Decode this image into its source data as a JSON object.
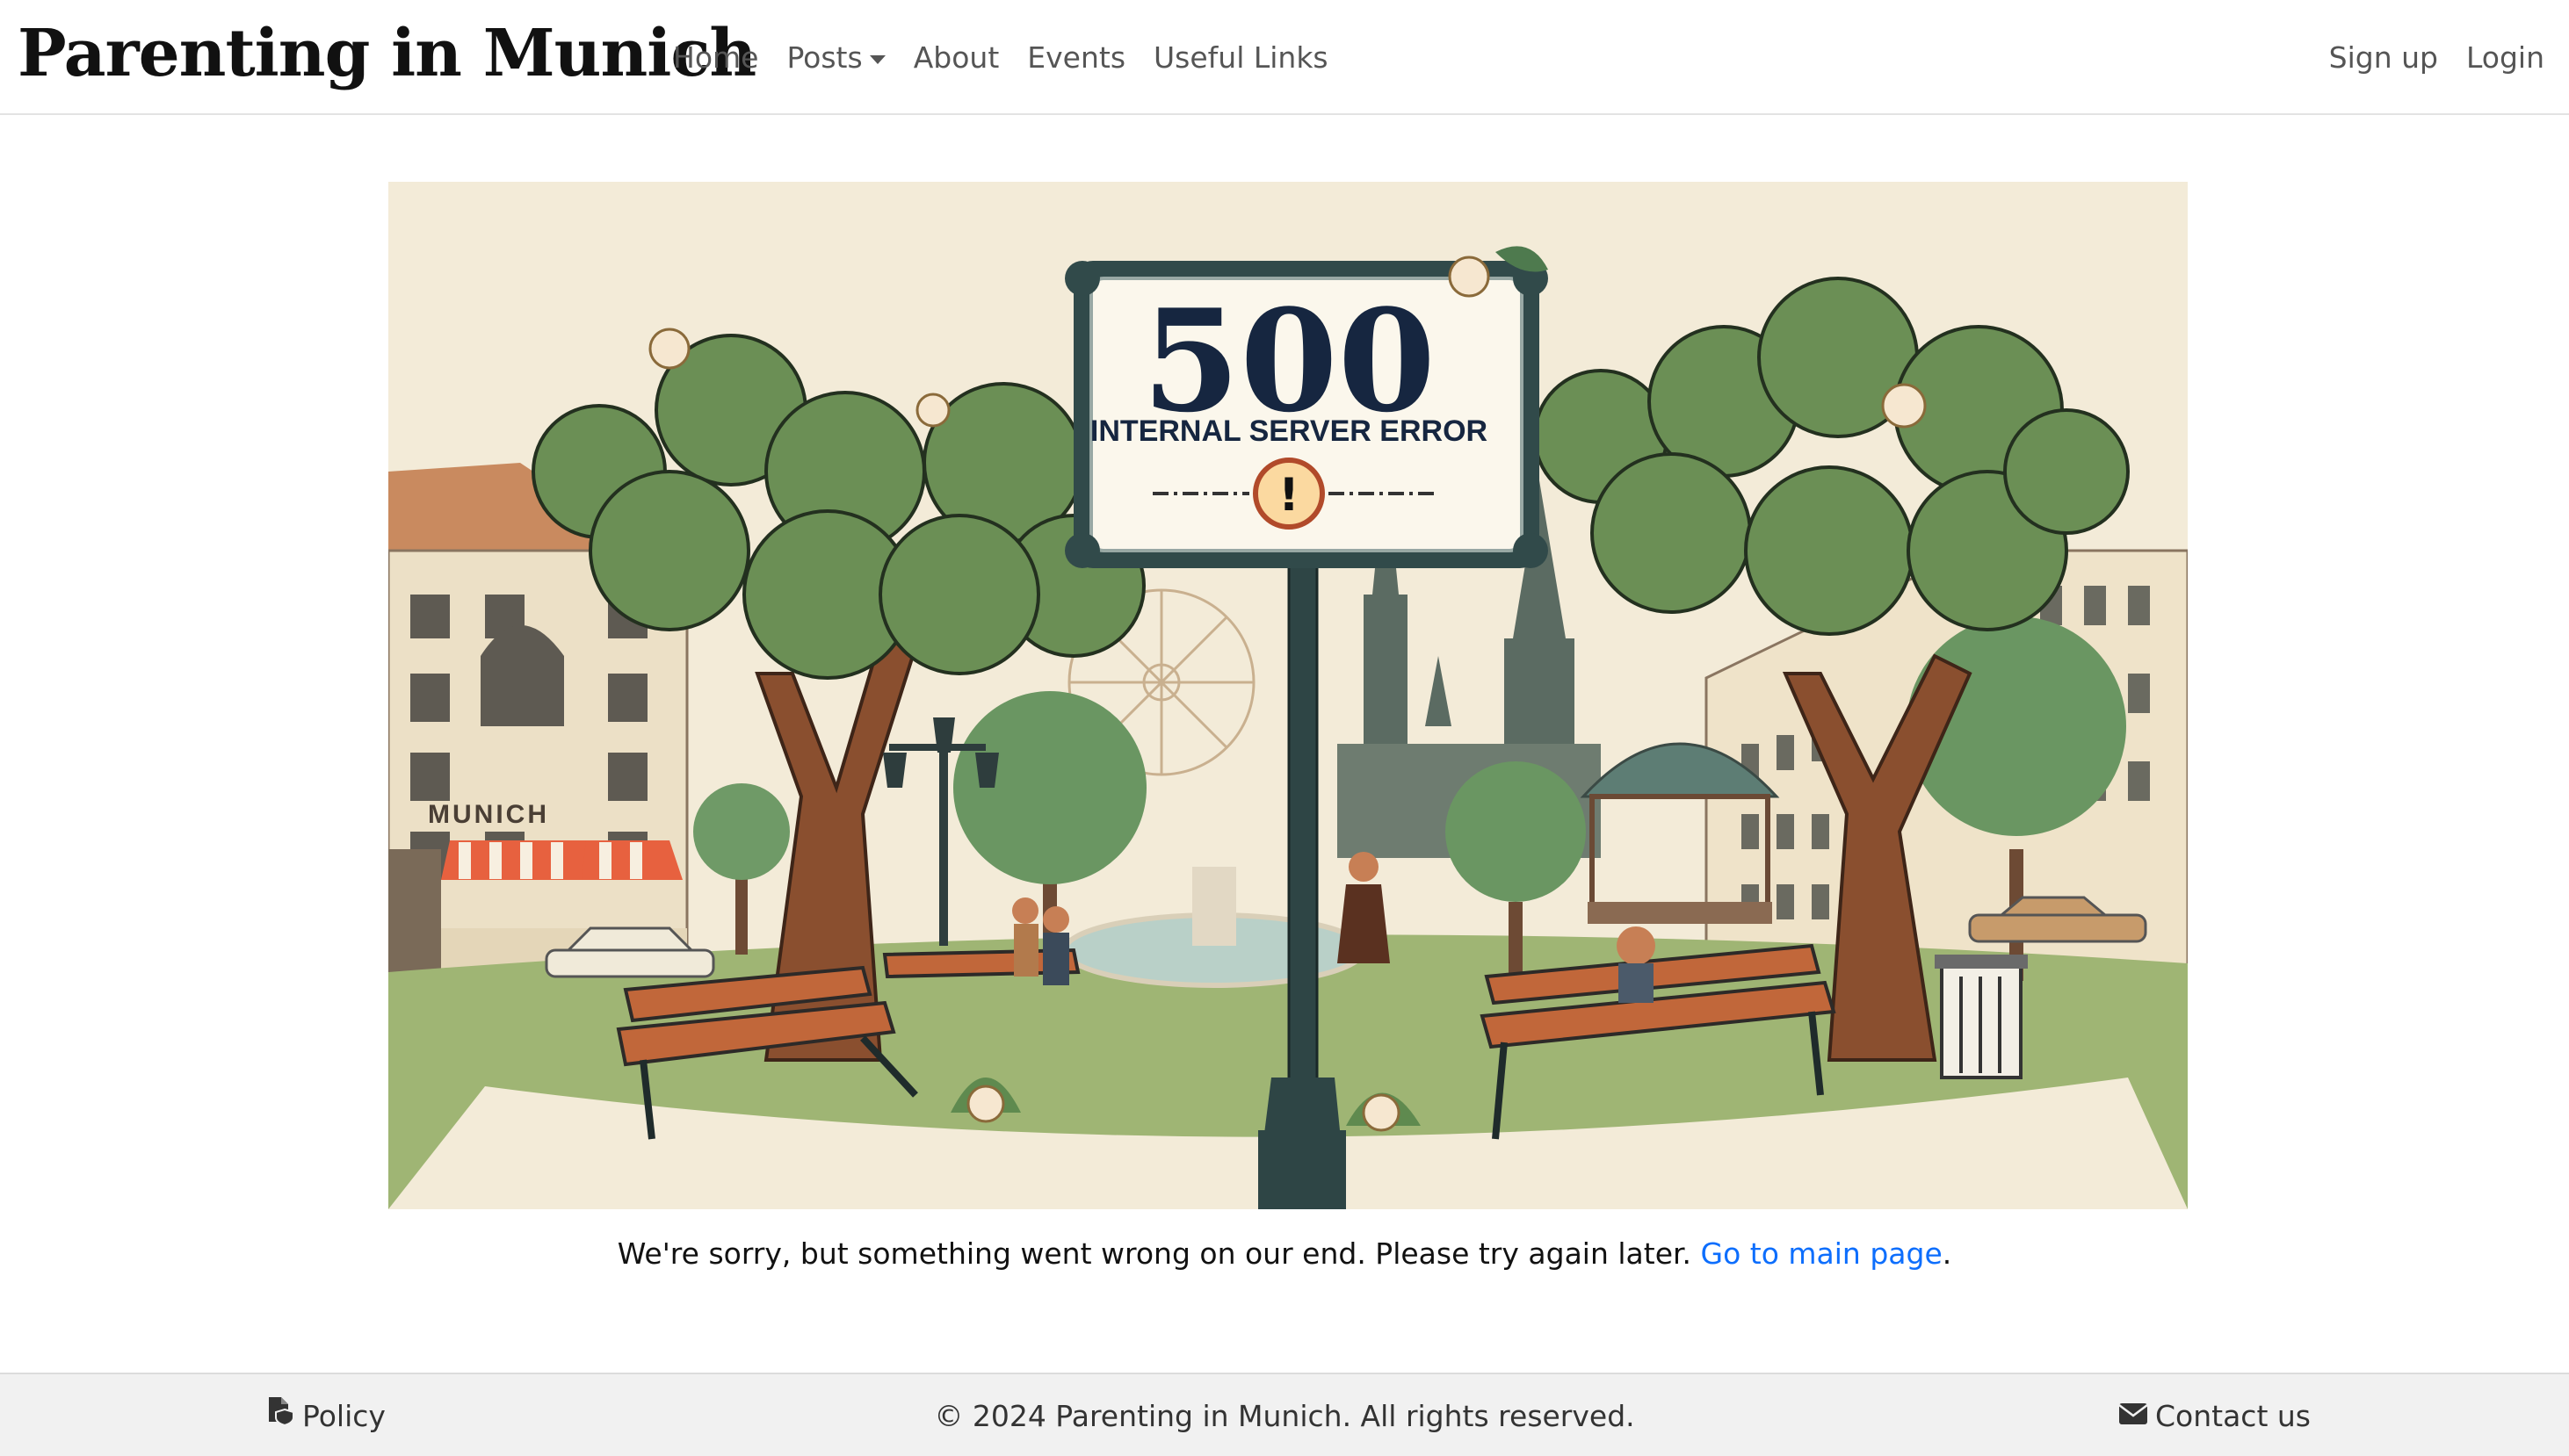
{
  "brand": "Parenting in Munich",
  "nav": {
    "home": "Home",
    "posts": "Posts",
    "about": "About",
    "events": "Events",
    "useful_links": "Useful Links",
    "signup": "Sign up",
    "login": "Login"
  },
  "hero": {
    "sign_code": "500",
    "sign_text": "INTERNAL SERVER ERROR",
    "sign_mark": "!",
    "storefront": "MUNICH"
  },
  "message": {
    "text": "We're sorry, but something went wrong on our end. Please try again later. ",
    "link": "Go to main page",
    "end": "."
  },
  "footer": {
    "policy": "Policy",
    "copyright": "© 2024 Parenting in Munich. All rights reserved.",
    "contact": "Contact us"
  },
  "colors": {
    "link": "#0d6efd",
    "footer_bg": "#f1f1f1"
  }
}
